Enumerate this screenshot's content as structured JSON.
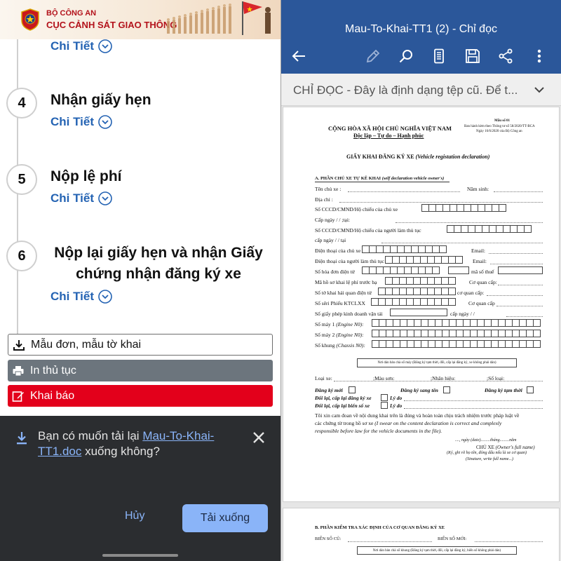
{
  "left": {
    "banner": {
      "ministry": "BỘ CÔNG AN",
      "department": "CỤC CẢNH SÁT GIAO THÔNG"
    },
    "detail_label": "Chi Tiết",
    "steps": [
      {
        "number": "4",
        "title": "Nhận giấy hẹn"
      },
      {
        "number": "5",
        "title": "Nộp lệ phí"
      },
      {
        "number": "6",
        "title": "Nộp lại giấy hẹn và nhận Giấy chứng nhận đăng ký xe"
      }
    ],
    "buttons": {
      "forms": "Mẫu đơn, mẫu tờ khai",
      "print": "In thủ tục",
      "declare": "Khai báo"
    },
    "colors": {
      "accent_blue": "#2463b3",
      "declare_red": "#e3001b",
      "print_gray": "#6c757d"
    }
  },
  "dialog": {
    "prefix": "Bạn có muốn tải lại ",
    "file_name": "Mau-To-Khai-TT1.doc",
    "suffix": " xuống không?",
    "cancel": "Hủy",
    "download": "Tải xuống"
  },
  "right": {
    "doc_title": "Mau-To-Khai-TT1 (2) - Chỉ đọc",
    "toolbar_icons": [
      "back-arrow-icon",
      "pen-icon",
      "search-icon",
      "mobile-view-icon",
      "save-icon",
      "share-icon",
      "more-icon"
    ],
    "notice": "CHỈ ĐỌC - Đây là định dạng tệp cũ. Để t...",
    "colors": {
      "appbar": "#2b579a"
    }
  },
  "form": {
    "nation": "CỘNG HÒA XÃ HỘI CHỦ NGHĨA VIỆT NAM",
    "motto": "Độc lập – Tự do – Hạnh phúc",
    "form_no": "Mẫu số 01",
    "form_ref1": "Ban hành kèm theo Thông tư số 58/2020/TT-BCA",
    "form_ref2": "Ngày 16/6/2020 của Bộ Công an",
    "title_vi": "GIẤY KHAI ĐĂNG KÝ XE",
    "title_en": "(Vehicle registation declaration)",
    "section_a": "A. PHẦN CHỦ XE TỰ KÊ KHAI",
    "section_a_en": "(self declaration vehicle owner's)",
    "f_owner": "Tên chủ xe :",
    "f_birth": "Năm sinh:",
    "f_address": "Địa chỉ :",
    "f_id_owner": "Số CCCD/CMND/Hộ chiếu của chủ xe",
    "f_issue_date": "Cấp ngày",
    "f_issue_sep": "/          /",
    "f_at": ";tại:",
    "f_id_agent": "Số CCCD/CMND/Hộ chiếu của người làm thủ tục",
    "f_issue_date2": "cấp ngày",
    "f_issue_sep2": "/        /",
    "f_at2": "tại",
    "f_phone_owner": "Điện thoại của chủ xe",
    "f_email": "Email:",
    "f_phone_agent": "Điện thoại của người làm thủ tục",
    "f_email2": "Email:",
    "f_einvoice": "Số hóa đơn điện tử",
    "f_taxcode": "mã số thuế",
    "f_fee_code": "Mã hồ sơ khai lệ phí trước bạ",
    "f_agency": "Cơ quan cấp:",
    "f_customs": "Số tờ khai hải quan điện tử",
    "f_agency2": "cơ quan cấp:",
    "f_kctclxx": "Số sêri Phiếu KTCLXX",
    "f_agency3": "Cơ quan cấp",
    "f_transport": "Số giấy phép kinh doanh vận tải",
    "f_issue_date3": "cấp ngày",
    "f_issue_sep3": "/        /",
    "f_engine1": "Số máy 1",
    "f_engine1_en": "(Engine N0):",
    "f_engine2": "Số máy 2",
    "f_engine2_en": "(Engine N0):",
    "f_chassis": "Số khung",
    "f_chassis_en": "(Chassis N0):",
    "stamp_note": "Nơi dán bản chà số máy (Đăng ký tạm thời, đổi, cấp lại đăng ký, xe không phải dán)",
    "f_type": "Loại xe:",
    "f_color": ";Màu sơn:",
    "f_brand": ";Nhãn hiệu:",
    "f_seats": ";Số loại:",
    "opt_new": "Đăng ký mới",
    "opt_transfer": "Đăng ký sang tên",
    "opt_temp": "Đăng ký tạm thời",
    "opt_reissue": "Đổi lại, cấp lại đăng ký xe",
    "opt_reason": "Lý do",
    "opt_plate": "Đổi lại, cấp lại biển số xe",
    "opt_reason2": "Lý do",
    "pledge_1": "Tôi xin cam đoan về nội dung khai trên là đúng và hoàn toàn chịu trách nhiệm trước pháp luật về",
    "pledge_2": "các chứng từ trong hồ sơ xe",
    "pledge_2b": "(I swear on the content declaration is correct and complexly",
    "pledge_3": "responsible before law for the vehicle documents in the file).",
    "date_line": "...., ngày (date).........tháng.........năm",
    "sign_title": "CHỦ XE",
    "sign_title_en": "(Owner's full name)",
    "sign_note1": "(Ký, ghi rõ họ tên, đóng dấu nếu là xe cơ quan)",
    "sign_note2": "(Sinature, write full name...)",
    "section_b": "B. PHẦN KIỂM TRA XÁC ĐỊNH CỦA CƠ QUAN ĐĂNG KÝ XE",
    "old_plate": "BIỂN SỐ CŨ:",
    "new_plate": "BIỂN SỐ MỚI:",
    "stamp_note_b": "Nơi dán bản chà số khung (Đăng ký tạm thời, đổi, cấp lại đăng ký, biển số không phải dán)"
  }
}
